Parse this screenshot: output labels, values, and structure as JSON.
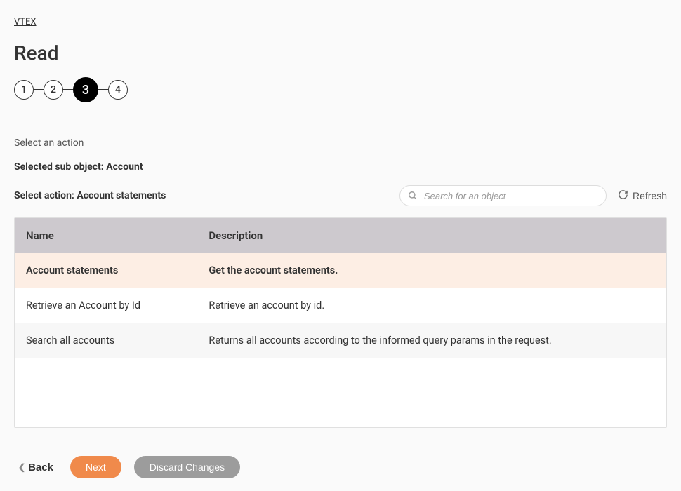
{
  "breadcrumb": "VTEX",
  "page_title": "Read",
  "stepper": {
    "steps": [
      "1",
      "2",
      "3",
      "4"
    ],
    "active_index": 2
  },
  "section_label": "Select an action",
  "sub_object_prefix": "Selected sub object: ",
  "sub_object_value": "Account",
  "select_action_prefix": "Select action: ",
  "select_action_value": "Account statements",
  "search": {
    "placeholder": "Search for an object",
    "value": ""
  },
  "refresh_label": "Refresh",
  "table": {
    "headers": {
      "name": "Name",
      "description": "Description"
    },
    "rows": [
      {
        "name": "Account statements",
        "description": "Get the account statements.",
        "selected": true
      },
      {
        "name": "Retrieve an Account by Id",
        "description": "Retrieve an account by id.",
        "selected": false
      },
      {
        "name": "Search all accounts",
        "description": "Returns all accounts according to the informed query params in the request.",
        "selected": false
      }
    ]
  },
  "footer": {
    "back": "Back",
    "next": "Next",
    "discard": "Discard Changes"
  }
}
